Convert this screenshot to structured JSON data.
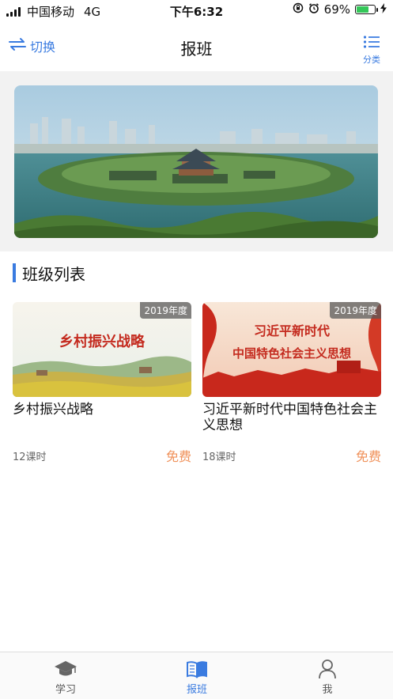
{
  "status_bar": {
    "carrier": "中国移动",
    "network": "4G",
    "time": "下午6:32",
    "battery": "69%",
    "battery_level": 0.69
  },
  "nav": {
    "switch_label": "切换",
    "title": "报班",
    "category_label": "分类"
  },
  "section": {
    "title": "班级列表"
  },
  "courses": [
    {
      "year_badge": "2019年度",
      "thumb_text": "乡村振兴战略",
      "title": "乡村振兴战略",
      "hours": "12课时",
      "price": "免费"
    },
    {
      "year_badge": "2019年度",
      "thumb_text_line1": "习近平新时代",
      "thumb_text_line2": "中国特色社会主义思想",
      "title": "习近平新时代中国特色社会主义思想",
      "hours": "18课时",
      "price": "免费"
    }
  ],
  "tabbar": {
    "items": [
      {
        "label": "学习",
        "icon": "graduation-cap-icon"
      },
      {
        "label": "报班",
        "icon": "open-book-icon",
        "active": true
      },
      {
        "label": "我",
        "icon": "person-icon"
      }
    ]
  },
  "colors": {
    "accent": "#3a7be0",
    "price": "#f0915a"
  }
}
